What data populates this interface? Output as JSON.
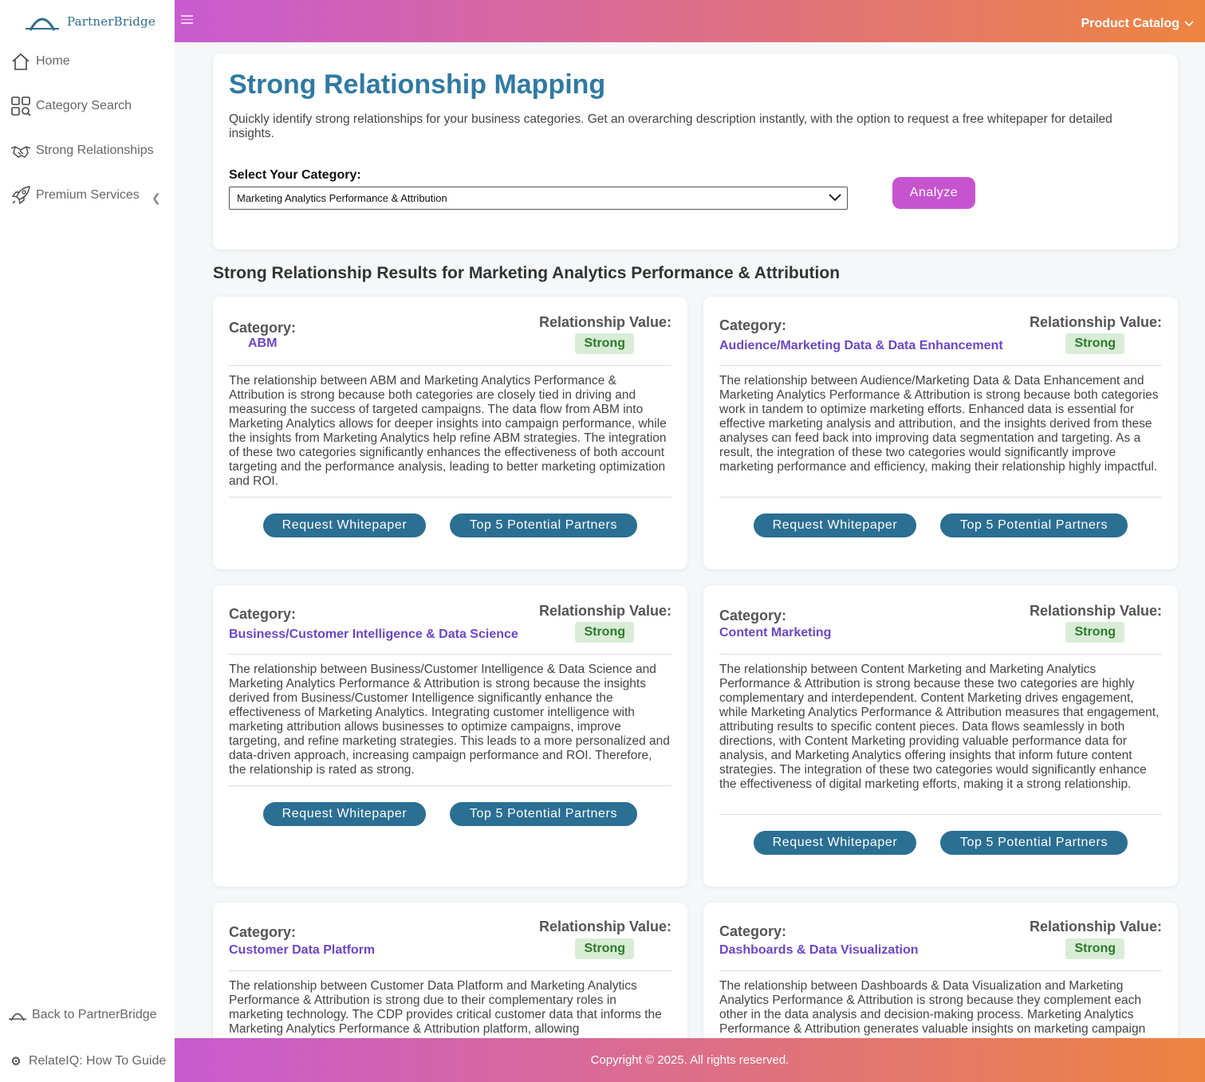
{
  "brand": {
    "name": "PartnerBridge"
  },
  "sidebar": {
    "items": [
      {
        "label": "Home",
        "icon": "home-icon"
      },
      {
        "label": "Category Search",
        "icon": "category-search-icon"
      },
      {
        "label": "Strong Relationships",
        "icon": "handshake-icon"
      },
      {
        "label": "Premium Services",
        "icon": "rocket-icon"
      }
    ],
    "back_label": "Back to PartnerBridge",
    "guide_label": "RelateIQ: How To Guide"
  },
  "header": {
    "menu_label": "Product Catalog"
  },
  "main": {
    "title": "Strong Relationship Mapping",
    "description": "Quickly identify strong relationships for your business categories. Get an overarching description instantly, with the option to request a free whitepaper for detailed insights.",
    "select_label": "Select Your Category:",
    "select_value": "Marketing Analytics Performance & Attribution",
    "analyze_label": "Analyze",
    "results_title": "Strong Relationship Results for Marketing Analytics Performance & Attribution"
  },
  "card_labels": {
    "category": "Category:",
    "relationship_value": "Relationship Value:",
    "whitepaper_button": "Request Whitepaper",
    "partners_button": "Top 5 Potential Partners"
  },
  "cards": [
    {
      "category": "ABM",
      "value": "Strong",
      "description": "The relationship between ABM and Marketing Analytics Performance & Attribution is strong because both categories are closely tied in driving and measuring the success of targeted campaigns. The data flow from ABM into Marketing Analytics allows for deeper insights into campaign performance, while the insights from Marketing Analytics help refine ABM strategies. The integration of these two categories significantly enhances the effectiveness of both account targeting and the performance analysis, leading to better marketing optimization and ROI."
    },
    {
      "category": "Audience/Marketing Data & Data Enhancement",
      "value": "Strong",
      "description": "The relationship between Audience/Marketing Data & Data Enhancement and Marketing Analytics Performance & Attribution is strong because both categories work in tandem to optimize marketing efforts. Enhanced data is essential for effective marketing analysis and attribution, and the insights derived from these analyses can feed back into improving data segmentation and targeting. As a result, the integration of these two categories would significantly improve marketing performance and efficiency, making their relationship highly impactful."
    },
    {
      "category": "Business/Customer Intelligence & Data Science",
      "value": "Strong",
      "description": "The relationship between Business/Customer Intelligence & Data Science and Marketing Analytics Performance & Attribution is strong because the insights derived from Business/Customer Intelligence significantly enhance the effectiveness of Marketing Analytics. Integrating customer intelligence with marketing attribution allows businesses to optimize campaigns, improve targeting, and refine marketing strategies. This leads to a more personalized and data-driven approach, increasing campaign performance and ROI. Therefore, the relationship is rated as strong."
    },
    {
      "category": "Content Marketing",
      "value": "Strong",
      "description": "The relationship between Content Marketing and Marketing Analytics Performance & Attribution is strong because these two categories are highly complementary and interdependent. Content Marketing drives engagement, while Marketing Analytics Performance & Attribution measures that engagement, attributing results to specific content pieces. Data flows seamlessly in both directions, with Content Marketing providing valuable performance data for analysis, and Marketing Analytics offering insights that inform future content strategies. The integration of these two categories would significantly enhance the effectiveness of digital marketing efforts, making it a strong relationship."
    },
    {
      "category": "Customer Data Platform",
      "value": "Strong",
      "description": "The relationship between Customer Data Platform and Marketing Analytics Performance & Attribution is strong due to their complementary roles in marketing technology. The CDP provides critical customer data that informs the Marketing Analytics Performance & Attribution platform, allowing"
    },
    {
      "category": "Dashboards & Data Visualization",
      "value": "Strong",
      "description": "The relationship between Dashboards & Data Visualization and Marketing Analytics Performance & Attribution is strong because they complement each other in the data analysis and decision-making process. Marketing Analytics Performance & Attribution generates valuable insights on marketing campaign"
    }
  ],
  "footer": {
    "text": "Copyright © 2025. All rights reserved."
  },
  "colors": {
    "accent_gradient_start": "#c85bd0",
    "accent_gradient_end": "#ee8440",
    "title_blue": "#2f7aa3",
    "button_blue": "#2b6f93",
    "category_purple": "#6b46c8",
    "badge_green_bg": "#d8ecd6"
  }
}
